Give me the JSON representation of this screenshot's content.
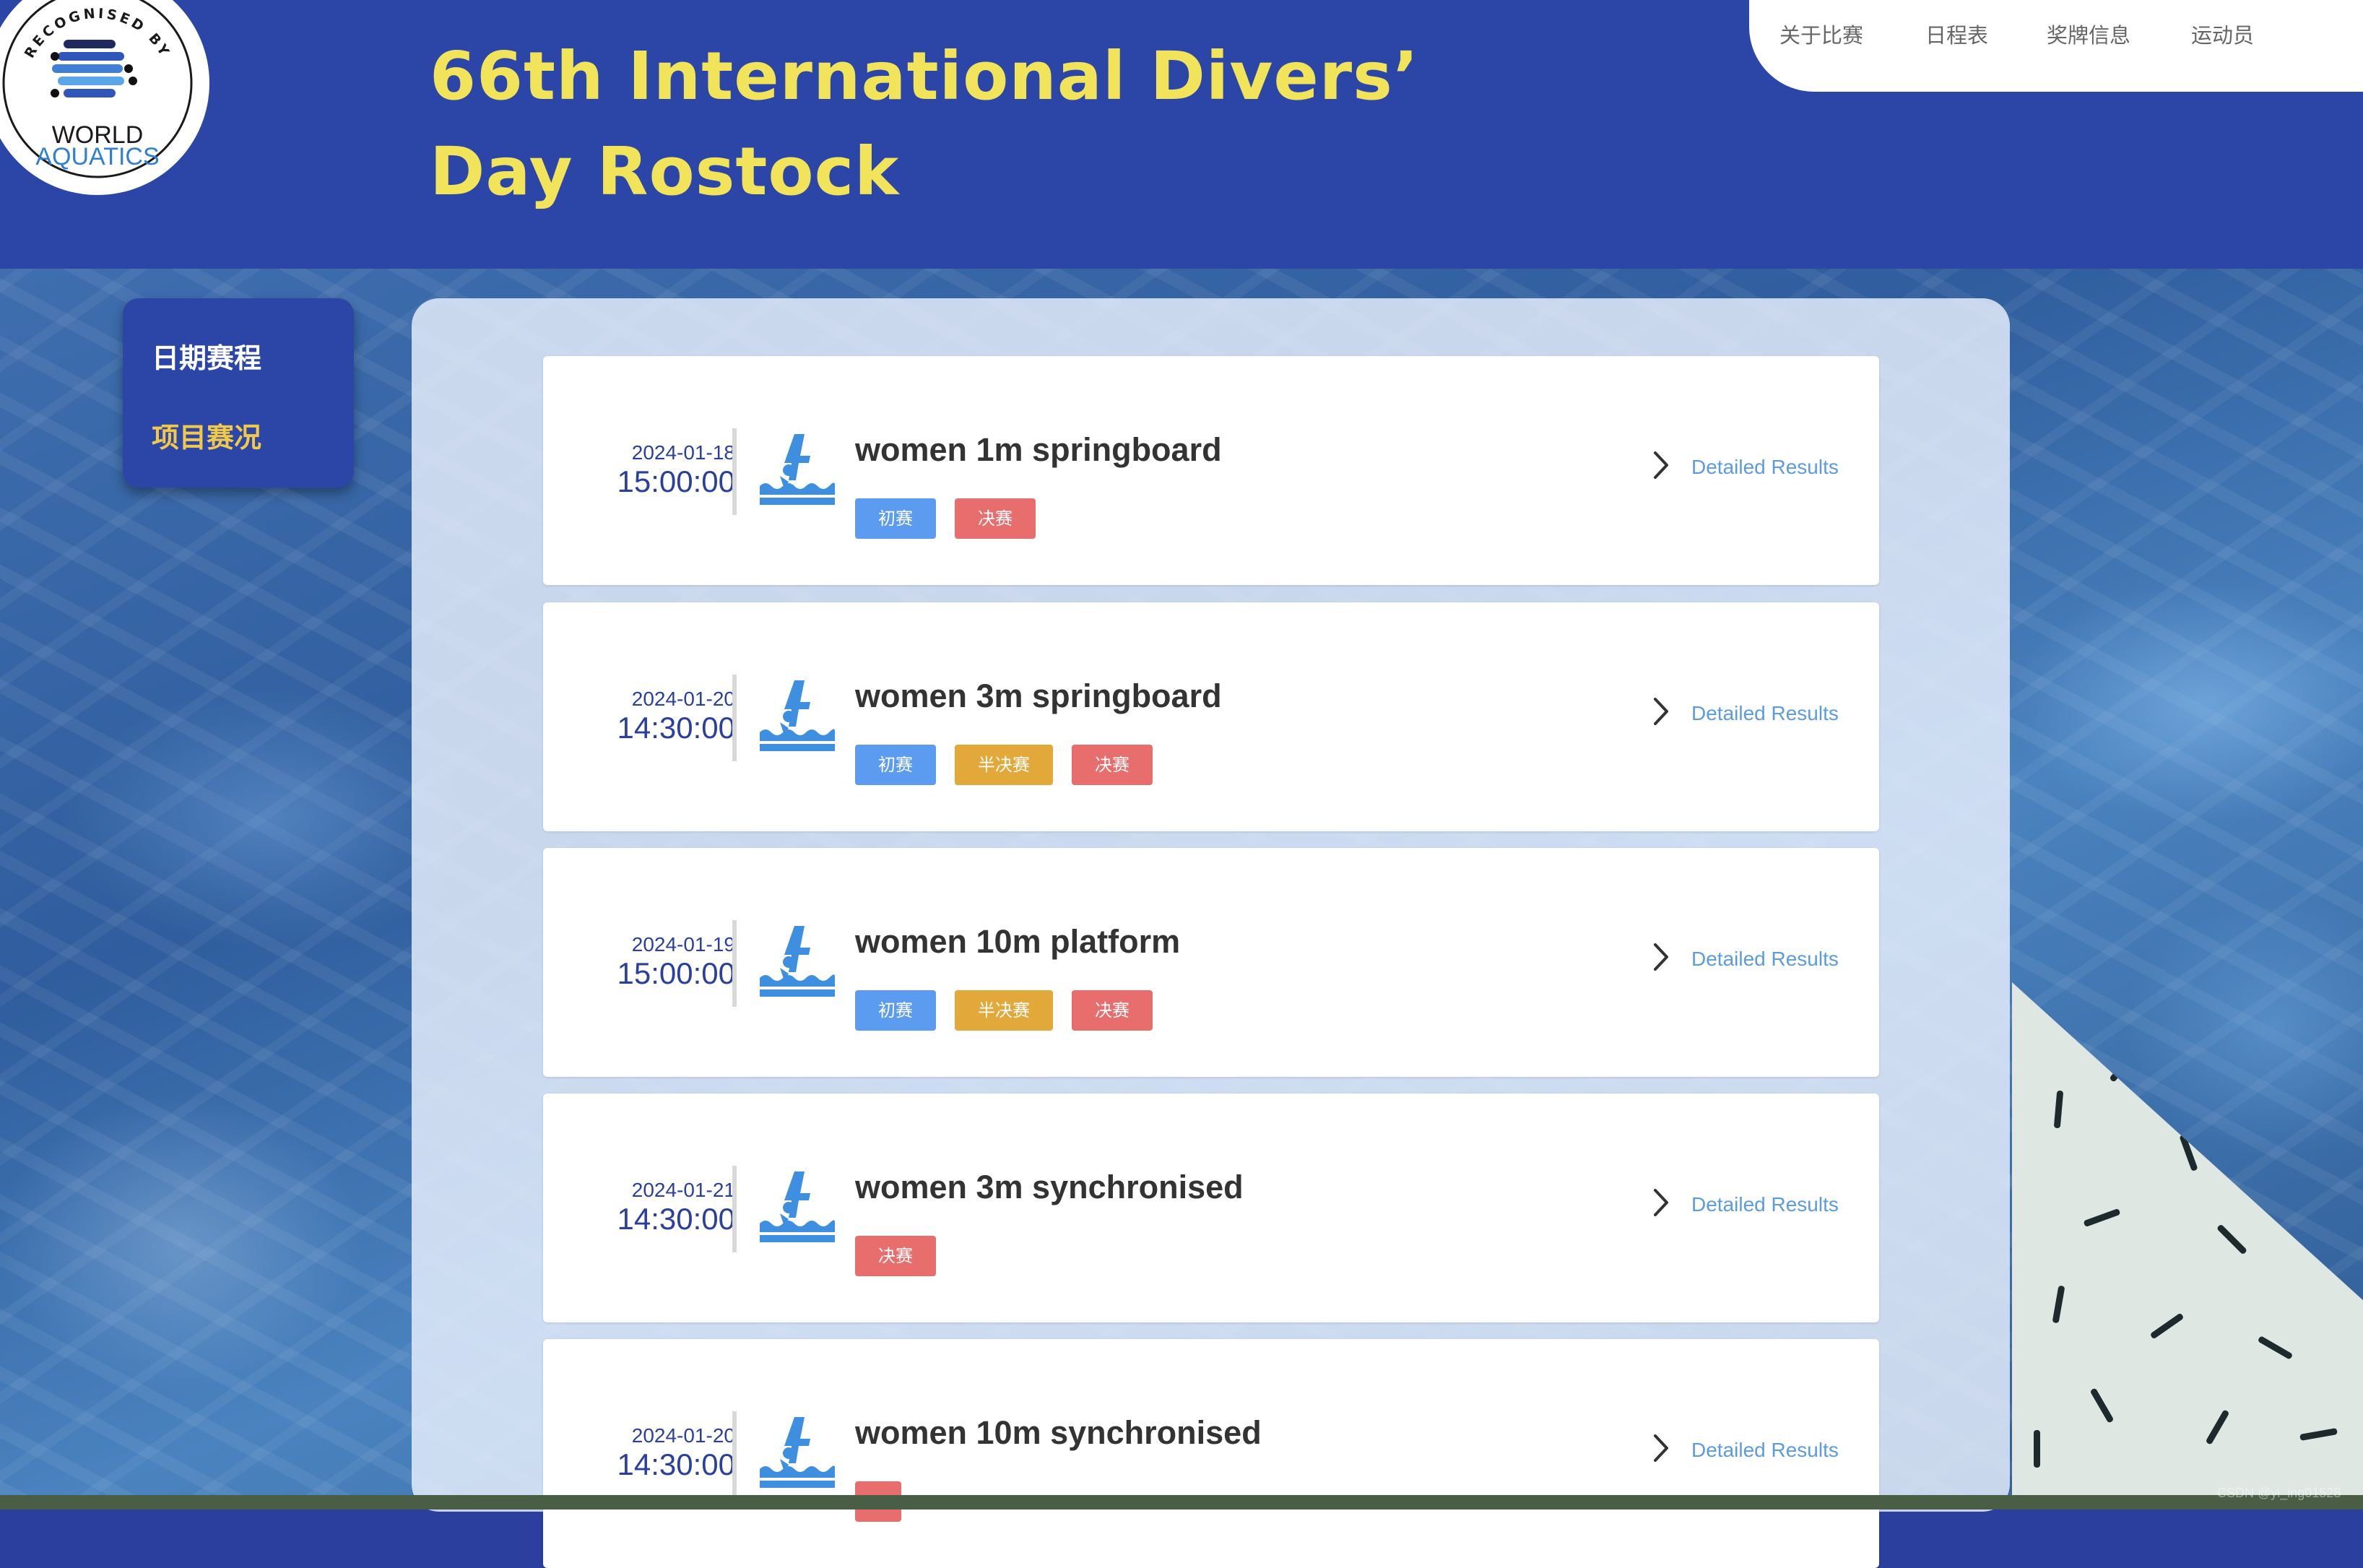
{
  "header": {
    "title_line1": "66th International Divers’",
    "title_line2": "Day Rostock",
    "logo": {
      "top_text": "RECOGNISED BY",
      "name_line1": "WORLD",
      "name_line2": "AQUATICS"
    }
  },
  "topnav": [
    {
      "label": "关于比赛"
    },
    {
      "label": "日程表"
    },
    {
      "label": "奖牌信息"
    },
    {
      "label": "运动员"
    }
  ],
  "sidemenu": [
    {
      "label": "日期赛程",
      "active": false
    },
    {
      "label": "项目赛况",
      "active": true
    }
  ],
  "events": [
    {
      "date": "2024-01-18",
      "time": "15:00:00",
      "name": "women 1m springboard",
      "tags": [
        {
          "label": "初赛",
          "type": "prelim"
        },
        {
          "label": "决赛",
          "type": "final"
        }
      ],
      "link": "Detailed Results"
    },
    {
      "date": "2024-01-20",
      "time": "14:30:00",
      "name": "women 3m springboard",
      "tags": [
        {
          "label": "初赛",
          "type": "prelim"
        },
        {
          "label": "半决赛",
          "type": "semi"
        },
        {
          "label": "决赛",
          "type": "final"
        }
      ],
      "link": "Detailed Results"
    },
    {
      "date": "2024-01-19",
      "time": "15:00:00",
      "name": "women 10m platform",
      "tags": [
        {
          "label": "初赛",
          "type": "prelim"
        },
        {
          "label": "半决赛",
          "type": "semi"
        },
        {
          "label": "决赛",
          "type": "final"
        }
      ],
      "link": "Detailed Results"
    },
    {
      "date": "2024-01-21",
      "time": "14:30:00",
      "name": "women 3m synchronised",
      "tags": [
        {
          "label": "决赛",
          "type": "final"
        }
      ],
      "link": "Detailed Results"
    },
    {
      "date": "2024-01-20",
      "time": "14:30:00",
      "name": "women 10m synchronised",
      "tags": [
        {
          "label": "",
          "type": "final"
        }
      ],
      "link": "Detailed Results"
    }
  ],
  "icons": {
    "event": "diver-icon",
    "detail": "chevron-right-icon"
  },
  "colors": {
    "header_bg": "#2b46a6",
    "title": "#f1e45a",
    "active_menu": "#f1c94a",
    "prelim": "#5b9bf0",
    "semi": "#e2a83a",
    "final": "#e86d6d",
    "link": "#5b9be0"
  },
  "watermark": "CSDN @yi_ing01528"
}
